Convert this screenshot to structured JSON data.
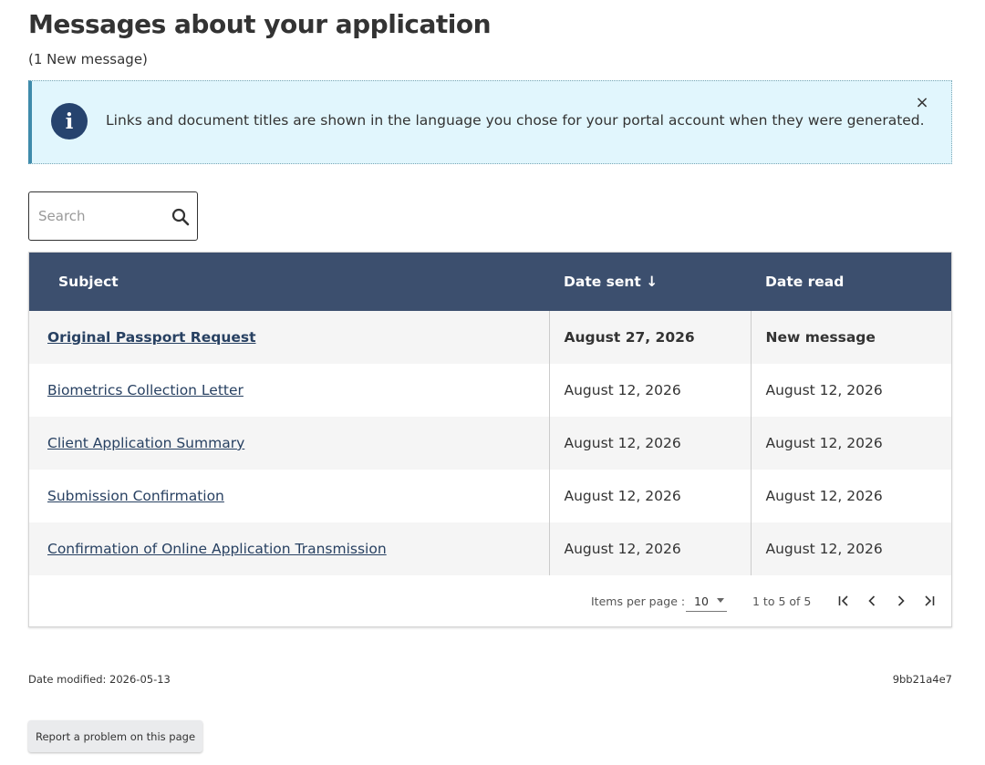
{
  "header": {
    "title": "Messages about your application",
    "new_count": "(1 New message)"
  },
  "alert": {
    "icon": "info-icon",
    "icon_glyph": "i",
    "text": "Links and document titles are shown in the language you chose for your portal account when they were generated.",
    "close_icon": "close-icon",
    "close_glyph": "×"
  },
  "search": {
    "placeholder": "Search",
    "value": "",
    "icon": "search-icon"
  },
  "table": {
    "columns": {
      "subject": "Subject",
      "date_sent": "Date sent ↓",
      "date_read": "Date read"
    },
    "rows": [
      {
        "subject": "Original Passport Request",
        "date_sent": "August 27, 2026",
        "date_read": "New message",
        "unread": true
      },
      {
        "subject": "Biometrics Collection Letter",
        "date_sent": "August 12, 2026",
        "date_read": "August 12, 2026",
        "unread": false
      },
      {
        "subject": "Client Application Summary",
        "date_sent": "August 12, 2026",
        "date_read": "August 12, 2026",
        "unread": false
      },
      {
        "subject": "Submission Confirmation",
        "date_sent": "August 12, 2026",
        "date_read": "August 12, 2026",
        "unread": false
      },
      {
        "subject": "Confirmation of Online Application Transmission",
        "date_sent": "August 12, 2026",
        "date_read": "August 12, 2026",
        "unread": false
      }
    ]
  },
  "pagination": {
    "items_per_page_label": "Items per page :",
    "items_per_page_value": "10",
    "range": "1 to 5 of 5",
    "first_icon": "first-page-icon",
    "prev_icon": "previous-page-icon",
    "next_icon": "next-page-icon",
    "last_icon": "last-page-icon"
  },
  "footer": {
    "date_modified": "Date modified: 2026-05-13",
    "version": "9bb21a4e7",
    "report_button": "Report a problem on this page"
  },
  "colors": {
    "table_header_bg": "#3c4f6e",
    "alert_bg": "#e1f6fd",
    "alert_accent": "#3f8bab",
    "info_icon_bg": "#26436e",
    "link": "#284162"
  }
}
